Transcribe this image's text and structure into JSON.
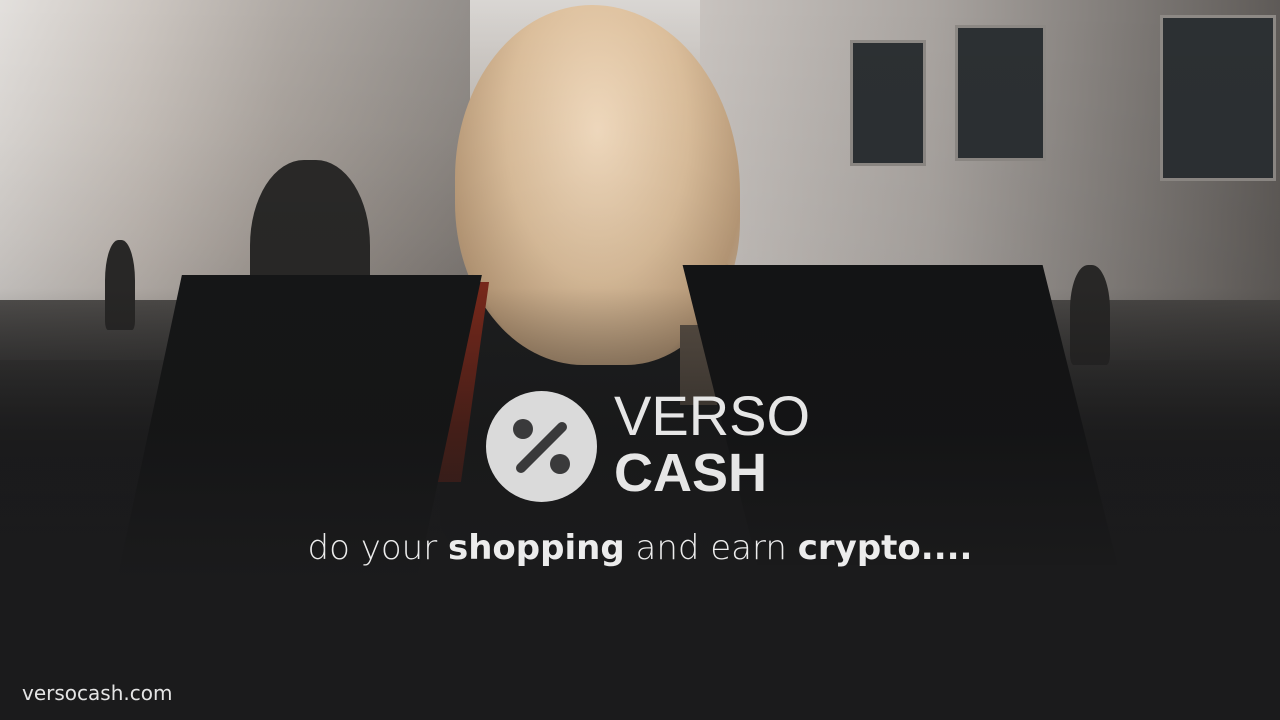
{
  "brand": {
    "name_line1": "VERSO",
    "name_line2": "CASH",
    "logo_icon": "percent-icon",
    "logo_color": "#dadada"
  },
  "tagline": {
    "part1": "do your ",
    "bold1": "shopping",
    "part2": " and earn ",
    "bold2": "crypto",
    "ellipsis": "...."
  },
  "footer": {
    "url": "versocash.com"
  },
  "colors": {
    "background": "#1b1b1c",
    "text": "#e6e6e6"
  }
}
